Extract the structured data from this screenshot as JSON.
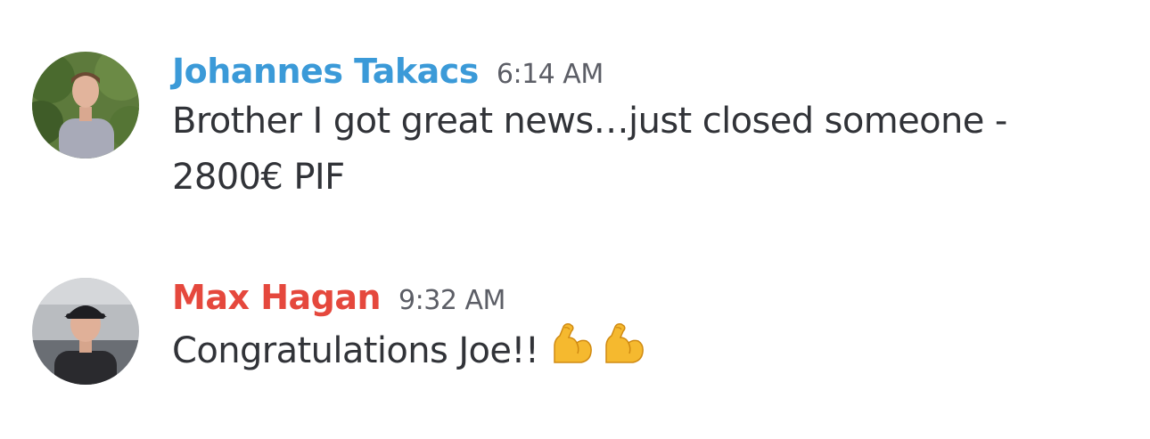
{
  "messages": [
    {
      "author": "Johannes Takacs",
      "author_color": "#3b9ad8",
      "timestamp": "6:14 AM",
      "text_lines": [
        "Brother I got great news…just closed someone -",
        "2800€ PIF"
      ],
      "avatar": "user-avatar-photo"
    },
    {
      "author": "Max Hagan",
      "author_color": "#e5483d",
      "timestamp": "9:32 AM",
      "text": "Congratulations Joe!!",
      "emojis": [
        "flexed-biceps-icon",
        "flexed-biceps-icon"
      ],
      "avatar": "user-avatar-photo"
    }
  ]
}
